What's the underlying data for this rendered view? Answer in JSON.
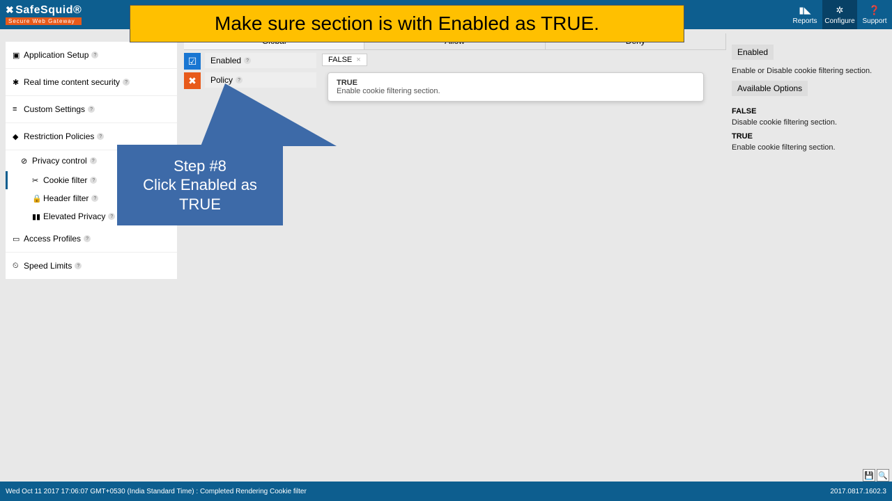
{
  "logo": {
    "brand": "SafeSquid®",
    "tagline": "Secure Web Gateway"
  },
  "topnav": {
    "reports": "Reports",
    "configure": "Configure",
    "support": "Support"
  },
  "banner": "Make sure section is with Enabled  as TRUE.",
  "sidebar": {
    "app_setup": "Application Setup",
    "rtcs": "Real time content security",
    "custom": "Custom Settings",
    "restriction": "Restriction Policies",
    "privacy": "Privacy control",
    "cookie": "Cookie filter",
    "header": "Header filter",
    "elevated": "Elevated Privacy",
    "access": "Access Profiles",
    "speed": "Speed Limits"
  },
  "tabs": {
    "global": "Global",
    "allow": "Allow",
    "deny": "Deny"
  },
  "config": {
    "enabled_label": "Enabled",
    "policy_label": "Policy",
    "false_chip": "FALSE"
  },
  "dropdown": {
    "true_title": "TRUE",
    "true_desc": "Enable cookie filtering section."
  },
  "callout": "Step #8\nClick Enabled as TRUE",
  "right": {
    "head": "Enabled",
    "desc": "Enable or Disable cookie filtering section.",
    "avail": "Available Options",
    "false_t": "FALSE",
    "false_d": "Disable cookie filtering section.",
    "true_t": "TRUE",
    "true_d": "Enable cookie filtering section."
  },
  "status": {
    "left": "Wed Oct 11 2017 17:06:07 GMT+0530 (India Standard Time) : Completed Rendering Cookie filter",
    "right": "2017.0817.1602.3"
  }
}
